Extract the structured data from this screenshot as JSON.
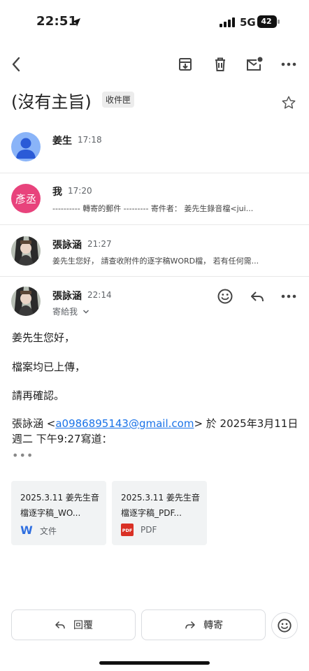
{
  "status_bar": {
    "time": "22:51",
    "network": "5G",
    "battery": "42",
    "location_icon": "location-arrow-icon",
    "signal_icon": "cell-signal-icon"
  },
  "toolbar": {
    "back_icon": "back-arrow-icon",
    "archive_icon": "archive-icon",
    "delete_icon": "trash-icon",
    "unread_icon": "mark-unread-icon",
    "more_icon": "more-horizontal-icon"
  },
  "subject": {
    "title": "(沒有主旨)",
    "label": "收件匣",
    "star_icon": "star-outline-icon"
  },
  "messages": [
    {
      "sender": "姜生",
      "time": "17:18",
      "snippet": ""
    },
    {
      "avatar_text": "彥丞",
      "avatar_color": "#e8437c",
      "sender": "我",
      "time": "17:20",
      "snippet": "---------- 轉寄的郵件 --------- 寄件者： 姜先生錄音檔<jui..."
    },
    {
      "sender": "張詠涵",
      "time": "21:27",
      "snippet": "姜先生您好， 請查收附件的逐字稿WORD檔， 若有任何需..."
    }
  ],
  "open_message": {
    "sender": "張詠涵",
    "time": "22:14",
    "recipient": "寄給我",
    "body_lines": [
      "姜先生您好，",
      "檔案均已上傳，",
      "請再確認。"
    ],
    "quote_prefix": "張詠涵 <",
    "quote_email": "a0986895143@gmail.com",
    "quote_suffix": "> 於 2025年3月11日 週二 下午9:27寫道：",
    "collapsed_dots": "•••"
  },
  "attachments": [
    {
      "name": "2025.3.11 姜先生音檔逐字稿_WO...",
      "type": "文件",
      "badge": "W",
      "badge_color": "#2f6fe0"
    },
    {
      "name": "2025.3.11 姜先生音檔逐字稿_PDF...",
      "type": "PDF",
      "badge": "PDF",
      "badge_color": "#d93025"
    }
  ],
  "actions": {
    "reply_label": "回覆",
    "forward_label": "轉寄"
  },
  "colors": {
    "accent": "#1a73e8",
    "default_avatar": "#8ab4f8"
  }
}
